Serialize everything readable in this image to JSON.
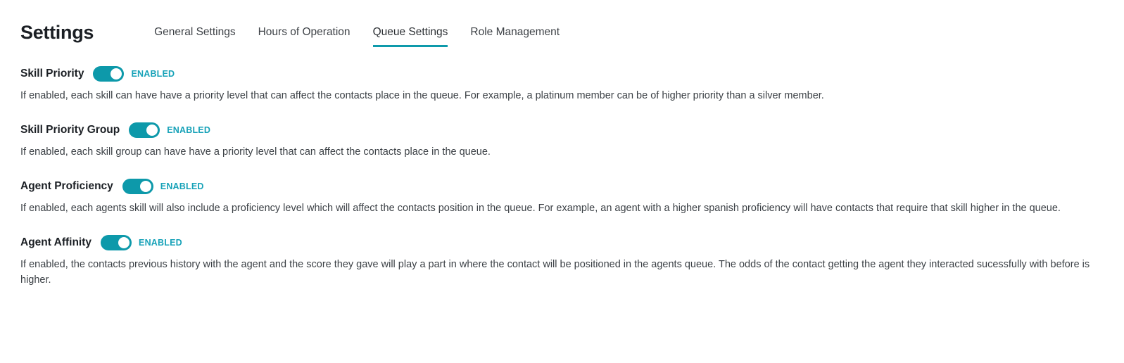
{
  "header": {
    "title": "Settings",
    "tabs": [
      {
        "label": "General Settings",
        "active": false
      },
      {
        "label": "Hours of Operation",
        "active": false
      },
      {
        "label": "Queue Settings",
        "active": true
      },
      {
        "label": "Role Management",
        "active": false
      }
    ]
  },
  "accent_color": "#0e9aab",
  "toggle_on_color": "#0d99aa",
  "enabled_text_color": "#17a2b8",
  "settings": [
    {
      "label": "Skill Priority",
      "toggle_state": "ENABLED",
      "enabled": true,
      "description": "If enabled, each skill can have have a priority level that can affect the contacts place in the queue. For example, a platinum member can be of higher priority than a silver member."
    },
    {
      "label": "Skill Priority Group",
      "toggle_state": "ENABLED",
      "enabled": true,
      "description": "If enabled, each skill group can have have a priority level that can affect the contacts place in the queue."
    },
    {
      "label": "Agent Proficiency",
      "toggle_state": "ENABLED",
      "enabled": true,
      "description": "If enabled, each agents skill will also include a proficiency level which will affect the contacts position in the queue. For example, an agent with a higher spanish proficiency will have contacts that require that skill higher in the queue."
    },
    {
      "label": "Agent Affinity",
      "toggle_state": "ENABLED",
      "enabled": true,
      "description": "If enabled, the contacts previous history with the agent and the score they gave will play a part in where the contact will be positioned in the agents queue. The odds of the contact getting the agent they interacted sucessfully with before is higher."
    }
  ]
}
